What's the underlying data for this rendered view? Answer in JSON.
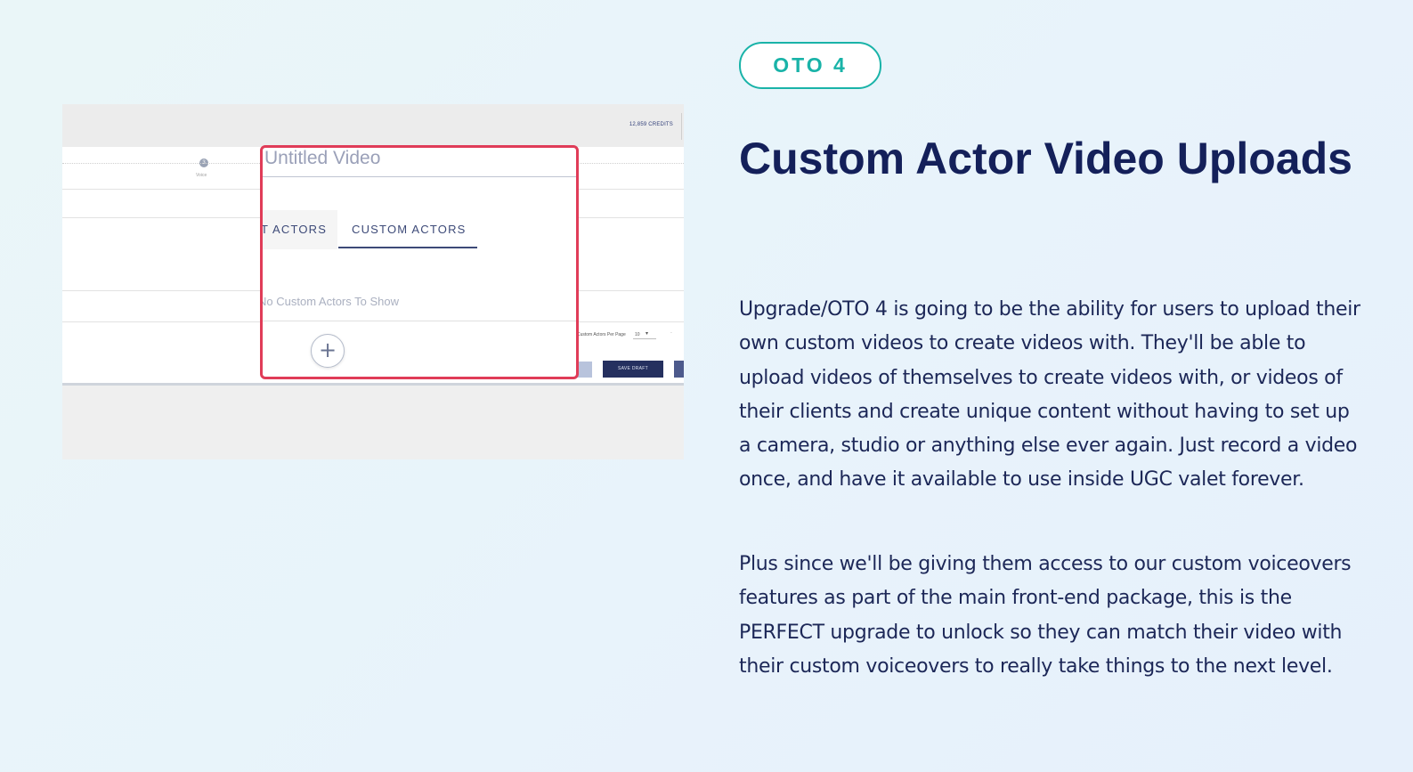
{
  "badge": "OTO 4",
  "heading": "Custom Actor Video Uploads",
  "paragraphs": [
    "Upgrade/OTO 4 is going to be the ability for users to upload their own custom videos to create videos with. They'll be able to upload videos of themselves to create videos with, or videos of their clients and create unique content without having to set up a camera, studio or anything else ever again. Just record a video once, and have it available to use inside UGC valet forever.",
    "Plus since we'll be giving them access to our custom voiceovers features as part of the main front-end package, this is the PERFECT upgrade to unlock so they can match their video with their custom voiceovers to really take things to the next level."
  ],
  "screenshot": {
    "credits": "12,859 CREDITS",
    "step_number": "3",
    "step_label": "Voice",
    "modal": {
      "title": "Untitled Video",
      "tab_left": "T ACTORS",
      "tab_right": "CUSTOM ACTORS",
      "empty_message": "No Custom Actors To Show",
      "add_symbol": "+"
    },
    "per_page_label": "Custom Actors Per Page",
    "per_page_value": "10",
    "per_page_caret": "▾",
    "save_draft": "SAVE DRAFT"
  },
  "colors": {
    "accent": "#19b3a8",
    "heading": "#14205a",
    "modal_border": "#e03c58"
  }
}
